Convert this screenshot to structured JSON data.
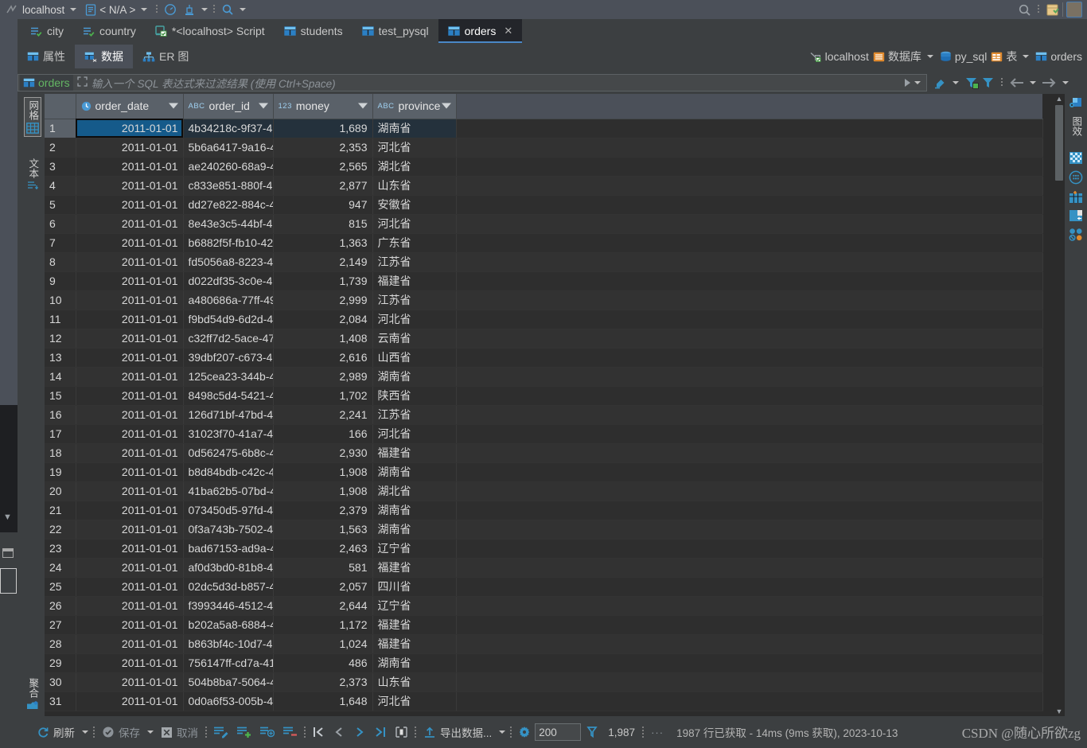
{
  "topbar": {
    "project": "localhost",
    "config": "< N/A >",
    "icons": [
      "run-icon",
      "profiler-icon",
      "build-icon",
      "search-icon",
      "notifications-icon",
      "avatar"
    ]
  },
  "tabs": [
    {
      "label": "city",
      "icon": "table-check-icon",
      "active": false,
      "closable": false
    },
    {
      "label": "country",
      "icon": "table-check-icon",
      "active": false,
      "closable": false
    },
    {
      "label": "*<localhost> Script",
      "icon": "console-icon",
      "active": false,
      "closable": false
    },
    {
      "label": "students",
      "icon": "table-icon",
      "active": false,
      "closable": false
    },
    {
      "label": "test_pysql",
      "icon": "table-icon",
      "active": false,
      "closable": false
    },
    {
      "label": "orders",
      "icon": "table-icon",
      "active": true,
      "closable": true,
      "close": "✕"
    }
  ],
  "subtabs": [
    {
      "label": "属性",
      "icon": "properties-icon",
      "active": false
    },
    {
      "label": "数据",
      "icon": "data-icon",
      "active": true
    },
    {
      "label": "ER 图",
      "icon": "er-diagram-icon",
      "active": false
    }
  ],
  "breadcrumbs": [
    {
      "label": "localhost",
      "icon": "server-icon"
    },
    {
      "label": "数据库",
      "icon": "database-group-icon",
      "caret": true
    },
    {
      "label": "py_sql",
      "icon": "schema-icon"
    },
    {
      "label": "表",
      "icon": "table-group-icon",
      "caret": true
    },
    {
      "label": "orders",
      "icon": "table-icon"
    }
  ],
  "filterbar": {
    "table_chip": "orders",
    "placeholder": "输入一个 SQL 表达式来过滤结果 (使用 Ctrl+Space)",
    "value": "",
    "tools": [
      "clear-filter-icon",
      "filter-applied-icon",
      "filter-icon",
      "nav-back-icon",
      "nav-forward-icon"
    ]
  },
  "left_rail": {
    "grid_label": "网格",
    "text_label": "文本",
    "value_label": "聚合"
  },
  "right_rail": {
    "label": "图效",
    "icons": [
      "data-extractor-icon",
      "transpose-icon",
      "circle-grid-icon",
      "add-column-icon",
      "layout-icon",
      "db-tools-icon"
    ]
  },
  "grid": {
    "columns": [
      {
        "name": "order_date",
        "type": "date",
        "type_badge": "clock-icon"
      },
      {
        "name": "order_id",
        "type": "text",
        "type_badge": "ABC"
      },
      {
        "name": "money",
        "type": "numeric",
        "type_badge": "123"
      },
      {
        "name": "province",
        "type": "text",
        "type_badge": "ABC"
      }
    ],
    "selected_cell": {
      "row": 1,
      "column": "order_date"
    },
    "rows": [
      {
        "n": 1,
        "order_date": "2011-01-01",
        "order_id": "4b34218c-9f37-4",
        "money": "1,689",
        "province": "湖南省"
      },
      {
        "n": 2,
        "order_date": "2011-01-01",
        "order_id": "5b6a6417-9a16-4",
        "money": "2,353",
        "province": "河北省"
      },
      {
        "n": 3,
        "order_date": "2011-01-01",
        "order_id": "ae240260-68a9-4",
        "money": "2,565",
        "province": "湖北省"
      },
      {
        "n": 4,
        "order_date": "2011-01-01",
        "order_id": "c833e851-880f-4",
        "money": "2,877",
        "province": "山东省"
      },
      {
        "n": 5,
        "order_date": "2011-01-01",
        "order_id": "dd27e822-884c-4",
        "money": "947",
        "province": "安徽省"
      },
      {
        "n": 6,
        "order_date": "2011-01-01",
        "order_id": "8e43e3c5-44bf-4",
        "money": "815",
        "province": "河北省"
      },
      {
        "n": 7,
        "order_date": "2011-01-01",
        "order_id": "b6882f5f-fb10-42",
        "money": "1,363",
        "province": "广东省"
      },
      {
        "n": 8,
        "order_date": "2011-01-01",
        "order_id": "fd5056a8-8223-4",
        "money": "2,149",
        "province": "江苏省"
      },
      {
        "n": 9,
        "order_date": "2011-01-01",
        "order_id": "d022df35-3c0e-4",
        "money": "1,739",
        "province": "福建省"
      },
      {
        "n": 10,
        "order_date": "2011-01-01",
        "order_id": "a480686a-77ff-49",
        "money": "2,999",
        "province": "江苏省"
      },
      {
        "n": 11,
        "order_date": "2011-01-01",
        "order_id": "f9bd54d9-6d2d-4",
        "money": "2,084",
        "province": "河北省"
      },
      {
        "n": 12,
        "order_date": "2011-01-01",
        "order_id": "c32ff7d2-5ace-47",
        "money": "1,408",
        "province": "云南省"
      },
      {
        "n": 13,
        "order_date": "2011-01-01",
        "order_id": "39dbf207-c673-4",
        "money": "2,616",
        "province": "山西省"
      },
      {
        "n": 14,
        "order_date": "2011-01-01",
        "order_id": "125cea23-344b-4",
        "money": "2,989",
        "province": "湖南省"
      },
      {
        "n": 15,
        "order_date": "2011-01-01",
        "order_id": "8498c5d4-5421-4",
        "money": "1,702",
        "province": "陕西省"
      },
      {
        "n": 16,
        "order_date": "2011-01-01",
        "order_id": "126d71bf-47bd-4",
        "money": "2,241",
        "province": "江苏省"
      },
      {
        "n": 17,
        "order_date": "2011-01-01",
        "order_id": "31023f70-41a7-4",
        "money": "166",
        "province": "河北省"
      },
      {
        "n": 18,
        "order_date": "2011-01-01",
        "order_id": "0d562475-6b8c-4",
        "money": "2,930",
        "province": "福建省"
      },
      {
        "n": 19,
        "order_date": "2011-01-01",
        "order_id": "b8d84bdb-c42c-4",
        "money": "1,908",
        "province": "湖南省"
      },
      {
        "n": 20,
        "order_date": "2011-01-01",
        "order_id": "41ba62b5-07bd-4",
        "money": "1,908",
        "province": "湖北省"
      },
      {
        "n": 21,
        "order_date": "2011-01-01",
        "order_id": "073450d5-97fd-4",
        "money": "2,379",
        "province": "湖南省"
      },
      {
        "n": 22,
        "order_date": "2011-01-01",
        "order_id": "0f3a743b-7502-4",
        "money": "1,563",
        "province": "湖南省"
      },
      {
        "n": 23,
        "order_date": "2011-01-01",
        "order_id": "bad67153-ad9a-4",
        "money": "2,463",
        "province": "辽宁省"
      },
      {
        "n": 24,
        "order_date": "2011-01-01",
        "order_id": "af0d3bd0-81b8-4",
        "money": "581",
        "province": "福建省"
      },
      {
        "n": 25,
        "order_date": "2011-01-01",
        "order_id": "02dc5d3d-b857-4",
        "money": "2,057",
        "province": "四川省"
      },
      {
        "n": 26,
        "order_date": "2011-01-01",
        "order_id": "f3993446-4512-4",
        "money": "2,644",
        "province": "辽宁省"
      },
      {
        "n": 27,
        "order_date": "2011-01-01",
        "order_id": "b202a5a8-6884-4",
        "money": "1,172",
        "province": "福建省"
      },
      {
        "n": 28,
        "order_date": "2011-01-01",
        "order_id": "b863bf4c-10d7-4",
        "money": "1,024",
        "province": "福建省"
      },
      {
        "n": 29,
        "order_date": "2011-01-01",
        "order_id": "756147ff-cd7a-41",
        "money": "486",
        "province": "湖南省"
      },
      {
        "n": 30,
        "order_date": "2011-01-01",
        "order_id": "504b8ba7-5064-4",
        "money": "2,373",
        "province": "山东省"
      },
      {
        "n": 31,
        "order_date": "2011-01-01",
        "order_id": "0d0a6f53-005b-4",
        "money": "1,648",
        "province": "河北省"
      }
    ]
  },
  "bottombar": {
    "refresh": "刷新",
    "save": "保存",
    "cancel": "取消",
    "export": "导出数据...",
    "row_limit": "200",
    "row_count": "1,987",
    "status": "1987 行已获取 - 14ms (9ms 获取), 2023-10-13"
  },
  "watermark": "CSDN @随心所欲zg",
  "colors": {
    "accent": "#4a88c7",
    "selection": "#155a8a",
    "link_green": "#63b563",
    "icon_blue": "#3592c4",
    "icon_orange": "#d9883a",
    "bg_panel": "#3c3f41",
    "bg_grid": "#2b2b2b",
    "header": "#5a6169"
  }
}
